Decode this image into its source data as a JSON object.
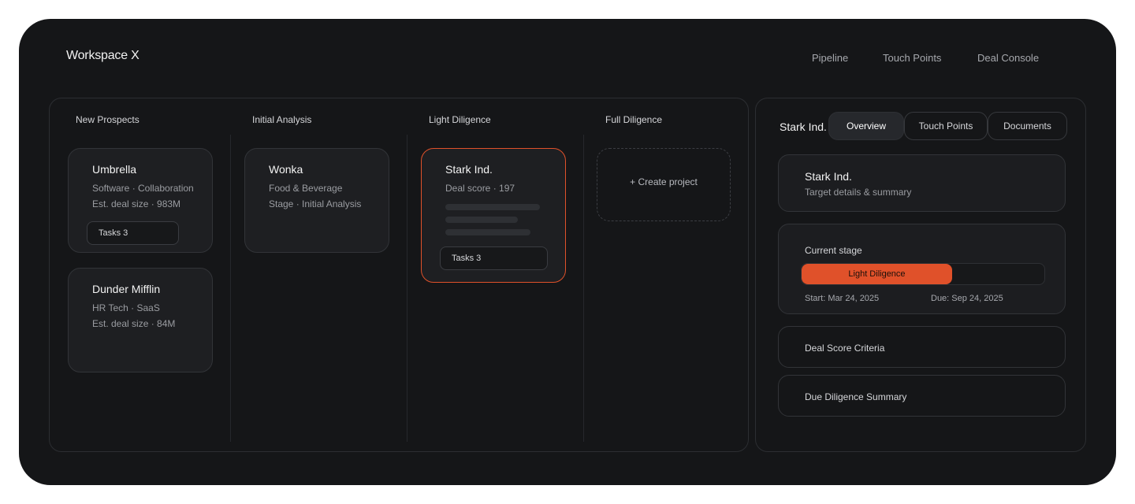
{
  "app": {
    "title": "Workspace X"
  },
  "nav": {
    "items": [
      "Pipeline",
      "Touch Points",
      "Deal Console"
    ]
  },
  "board": {
    "columns": [
      "New Prospects",
      "Initial Analysis",
      "Light Diligence",
      "Full Diligence"
    ],
    "cards": {
      "umbrella": {
        "title": "Umbrella",
        "line1": "Software · Collaboration",
        "line2": "Est. deal size · 983M",
        "tasks": "Tasks 3"
      },
      "dunder": {
        "title": "Dunder Mifflin",
        "line1": "HR Tech · SaaS",
        "line2": "Est. deal size · 84M"
      },
      "wonka": {
        "title": "Wonka",
        "line1": "Food & Beverage",
        "line2": "Stage · Initial Analysis"
      },
      "stark": {
        "title": "Stark Ind.",
        "line1": "Deal score · 197",
        "tasks": "Tasks 3"
      }
    },
    "create_label": "+ Create project"
  },
  "detail": {
    "name": "Stark Ind.",
    "tabs": [
      "Overview",
      "Touch Points",
      "Documents"
    ],
    "selected_tab": "Overview",
    "summary": {
      "title": "Stark Ind.",
      "subtitle": "Target details & summary"
    },
    "stage": {
      "label": "Current stage",
      "value": "Light Diligence",
      "progress": 0.62,
      "start": "Start: Mar 24, 2025",
      "due": "Due: Sep 24, 2025"
    },
    "sections": [
      "Deal Score Criteria",
      "Due Diligence Summary"
    ]
  },
  "colors": {
    "accent": "#e0512a",
    "background": "#151618",
    "card": "#1e1f22"
  }
}
